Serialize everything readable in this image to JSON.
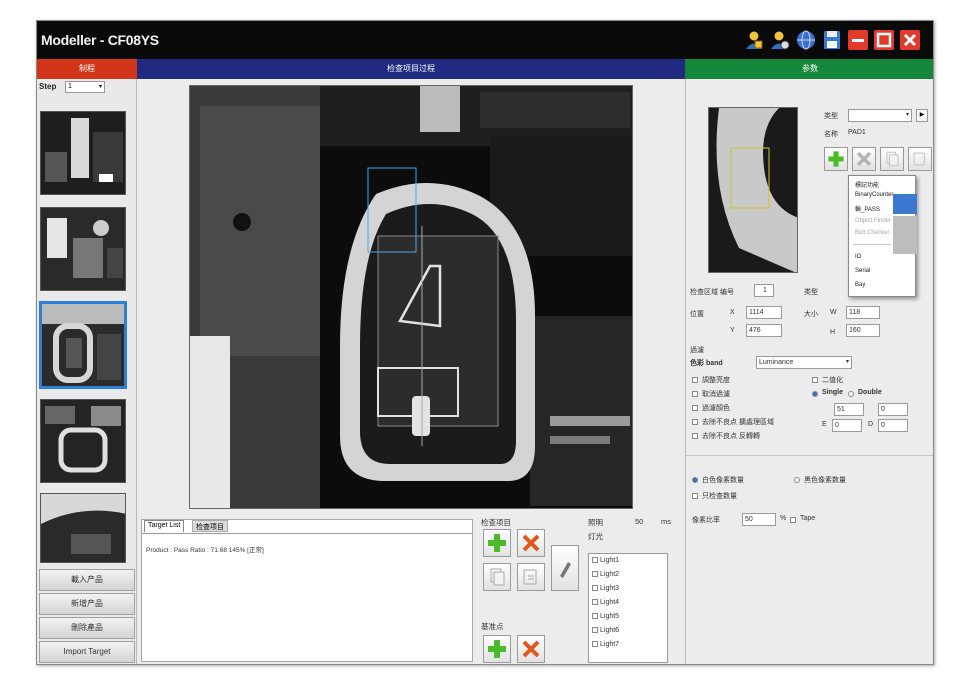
{
  "window": {
    "title": "Modeller - CF08YS"
  },
  "section_tabs": [
    {
      "label": "制程",
      "color": "#d2361a"
    },
    {
      "label": "检查项目过程",
      "color": "#1f2a80"
    },
    {
      "label": "参数",
      "color": "#14873a"
    }
  ],
  "left": {
    "step_label": "Step",
    "step_value": "1",
    "buttons": [
      "載入产品",
      "新增产品",
      "刪除產品",
      "Import Target"
    ]
  },
  "target_list": {
    "tabs": [
      "Target List",
      "检查项目"
    ],
    "result_text": "Product : Pass Ratio : 71.68 145% [正常]"
  },
  "tools": {
    "group1_label": "检查项目",
    "group2_label": "基准点",
    "lights_label": "照明",
    "lights_value": "50",
    "lights_unit": "ms",
    "light_list_label": "灯光",
    "lights": [
      "Light1",
      "Light2",
      "Light3",
      "Light4",
      "Light5",
      "Light6",
      "Light7"
    ]
  },
  "right": {
    "type_label": "类型",
    "type_value": "",
    "name_label": "名称",
    "name_value": "PAD1",
    "menu_items": [
      {
        "label": "標記功能",
        "enabled": true
      },
      {
        "label": "BinaryCounter",
        "enabled": true
      },
      {
        "label": "輪_PASS",
        "enabled": true
      },
      {
        "label": "Object Finder",
        "enabled": false
      },
      {
        "label": "Bolt Checker",
        "enabled": false
      },
      {
        "label": "IO",
        "enabled": true
      },
      {
        "label": "Serial",
        "enabled": true
      },
      {
        "label": "Bay",
        "enabled": true
      }
    ],
    "region_label": "检查区域 编号",
    "region_number": "1",
    "shape_label": "类型",
    "position_label": "位置",
    "x_label": "X",
    "x_value": "1114",
    "y_label": "Y",
    "y_value": "476",
    "size_label": "大小",
    "w_label": "W",
    "w_value": "118",
    "h_label": "H",
    "h_value": "160",
    "filter_label": "過濾",
    "color_band_label": "色彩 band",
    "color_band_value": "Luminance",
    "options": [
      "調整亮度",
      "取消過濾",
      "過濾顏色",
      "去除不良点 擴處理區域",
      "去除不良点 反轉轉"
    ],
    "binary_label": "二值化",
    "single_label": "Single",
    "double_label": "Double",
    "threshold_value": "51",
    "threshold_value2": "0",
    "e_label": "E",
    "e_value": "0",
    "d_label": "D",
    "d_value": "0",
    "count_white_label": "白色像素数量",
    "count_black_label": "黑色像素数量",
    "count_only_label": "只检查数量",
    "ratio_label": "像素比率",
    "ratio_value": "50",
    "ratio_unit": "%",
    "tape_label": "Tape"
  }
}
